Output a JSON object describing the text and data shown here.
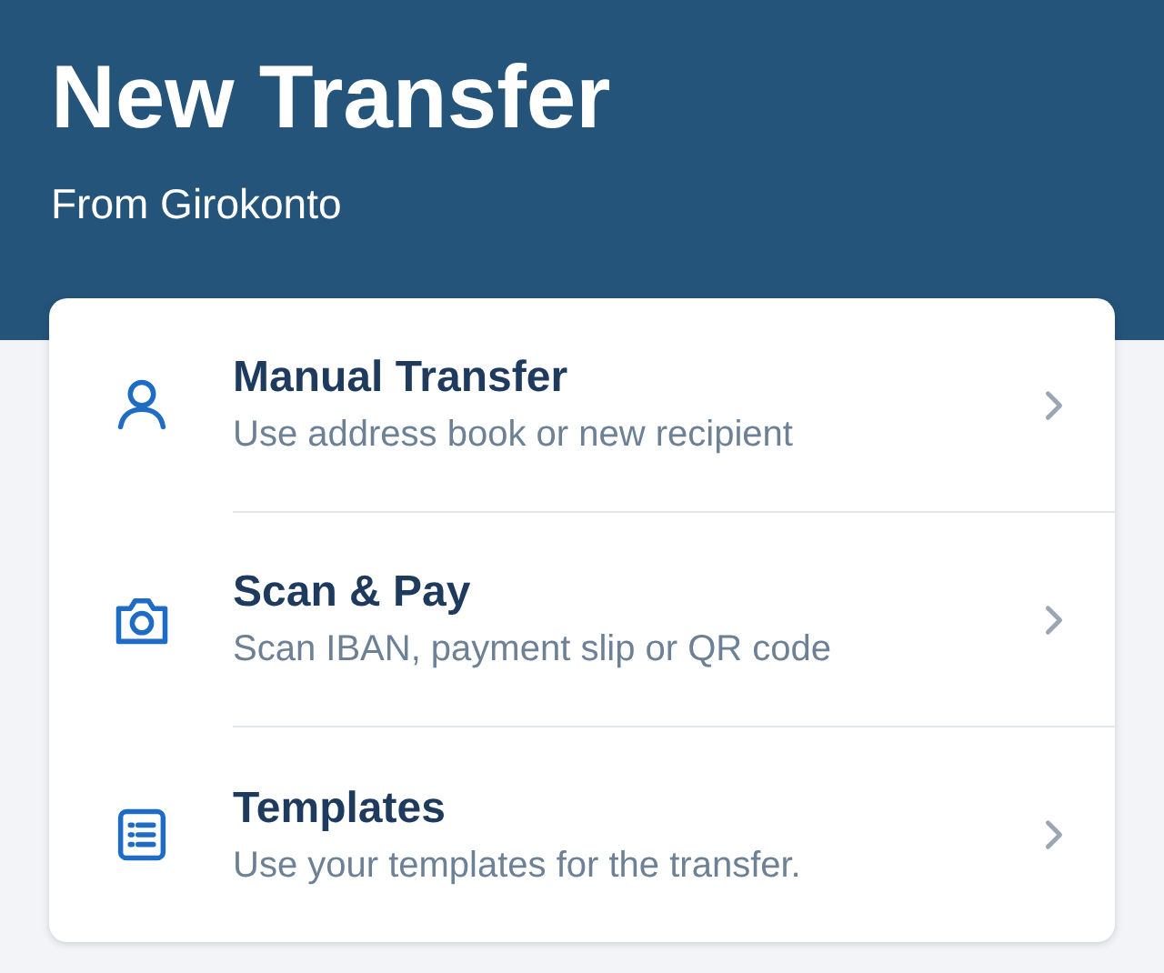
{
  "header": {
    "title": "New Transfer",
    "subtitle": "From Girokonto"
  },
  "options": [
    {
      "kind": "person",
      "title": "Manual Transfer",
      "description": "Use address book or new recipient"
    },
    {
      "kind": "camera",
      "title": "Scan & Pay",
      "description": "Scan IBAN, payment slip or QR code"
    },
    {
      "kind": "list",
      "title": "Templates",
      "description": "Use your templates for the transfer."
    }
  ]
}
